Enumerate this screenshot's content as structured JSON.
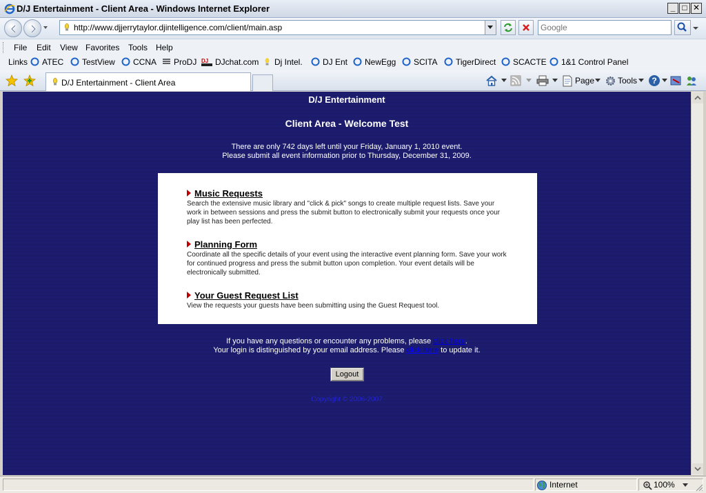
{
  "window": {
    "title": "D/J Entertainment - Client Area - Windows Internet Explorer",
    "minimize": "_",
    "maximize": "□",
    "close": "✕"
  },
  "address_bar": {
    "url": "http://www.djjerrytaylor.djintelligence.com/client/main.asp"
  },
  "search": {
    "placeholder": "Google"
  },
  "menu": {
    "items": [
      {
        "label": "File"
      },
      {
        "label": "Edit"
      },
      {
        "label": "View"
      },
      {
        "label": "Favorites"
      },
      {
        "label": "Tools"
      },
      {
        "label": "Help"
      }
    ]
  },
  "links_bar": {
    "label": "Links",
    "items": [
      {
        "label": "ATEC"
      },
      {
        "label": "TestView"
      },
      {
        "label": "CCNA"
      },
      {
        "label": "ProDJ"
      },
      {
        "label": "DJchat.com"
      },
      {
        "label": "Dj Intel."
      },
      {
        "label": "DJ Ent"
      },
      {
        "label": "NewEgg"
      },
      {
        "label": "SCITA"
      },
      {
        "label": "TigerDirect"
      },
      {
        "label": "SCACTE"
      },
      {
        "label": "1&1 Control Panel"
      }
    ]
  },
  "tabs": {
    "active_label": "D/J Entertainment - Client Area"
  },
  "command_bar": {
    "page": "Page",
    "tools": "Tools"
  },
  "content": {
    "site_title": "D/J Entertainment",
    "welcome": "Client Area - Welcome Test",
    "days_line": "There are only 742 days left until your Friday, January 1, 2010 event.",
    "submit_line": "Please submit all event information prior to Thursday, December 31, 2009.",
    "sections": [
      {
        "title": "Music Requests",
        "desc": "Search the extensive music library and \"click & pick\" songs to create multiple request lists. Save your work in between sessions and press the submit button to electronically submit your requests once your play list has been perfected."
      },
      {
        "title": "Planning Form",
        "desc": "Coordinate all the specific details of your event using the interactive event planning form. Save your work for continued progress and press the submit button upon completion. Your event details will be electronically submitted."
      },
      {
        "title": "Your Guest Request List",
        "desc": "View the requests your guests have been submitting using the Guest Request tool."
      }
    ],
    "help_line1_pre": "If you have any questions or encounter any problems, please",
    "help_line1_link": "click here",
    "help_line1_post": ".",
    "help_line2_pre": "Your login is distinguished by your email address. Please",
    "help_line2_link": "click here",
    "help_line2_post": "to update it.",
    "logout_label": "Logout",
    "copyright": "Copyright © 2006-2007"
  },
  "status_bar": {
    "zone": "Internet",
    "zoom": "100%"
  },
  "colors": {
    "page_bg": "#1b1b6e",
    "panel_bg": "#ffffff",
    "arrow": "#c00000",
    "link": "#0000ee"
  }
}
